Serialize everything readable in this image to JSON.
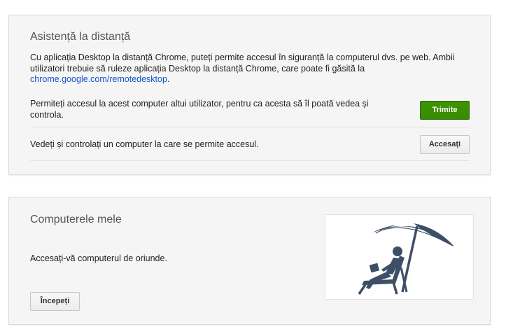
{
  "remote_assistance": {
    "title": "Asistență la distanță",
    "intro_text": "Cu aplicația Desktop la distanță Chrome, puteți permite accesul în siguranță la computerul dvs. pe web. Ambii utilizatori trebuie să ruleze aplicația Desktop la distanță Chrome, care poate fi găsită la ",
    "intro_link": "chrome.google.com/remotedesktop",
    "intro_end": ".",
    "share_text": "Permiteți accesul la acest computer altui utilizator, pentru ca acesta să îl poată vedea și controla.",
    "share_button": "Trimite",
    "access_text": "Vedeți și controlați un computer la care se permite accesul.",
    "access_button": "Accesați"
  },
  "my_computers": {
    "title": "Computerele mele",
    "description": "Accesați-vă computerul de oriunde.",
    "start_button": "Începeți",
    "illustration": "beach-umbrella-laptop-illustration"
  },
  "colors": {
    "primary_button": "#3d9400",
    "link": "#1155cc",
    "illustration": "#3d4f66"
  }
}
